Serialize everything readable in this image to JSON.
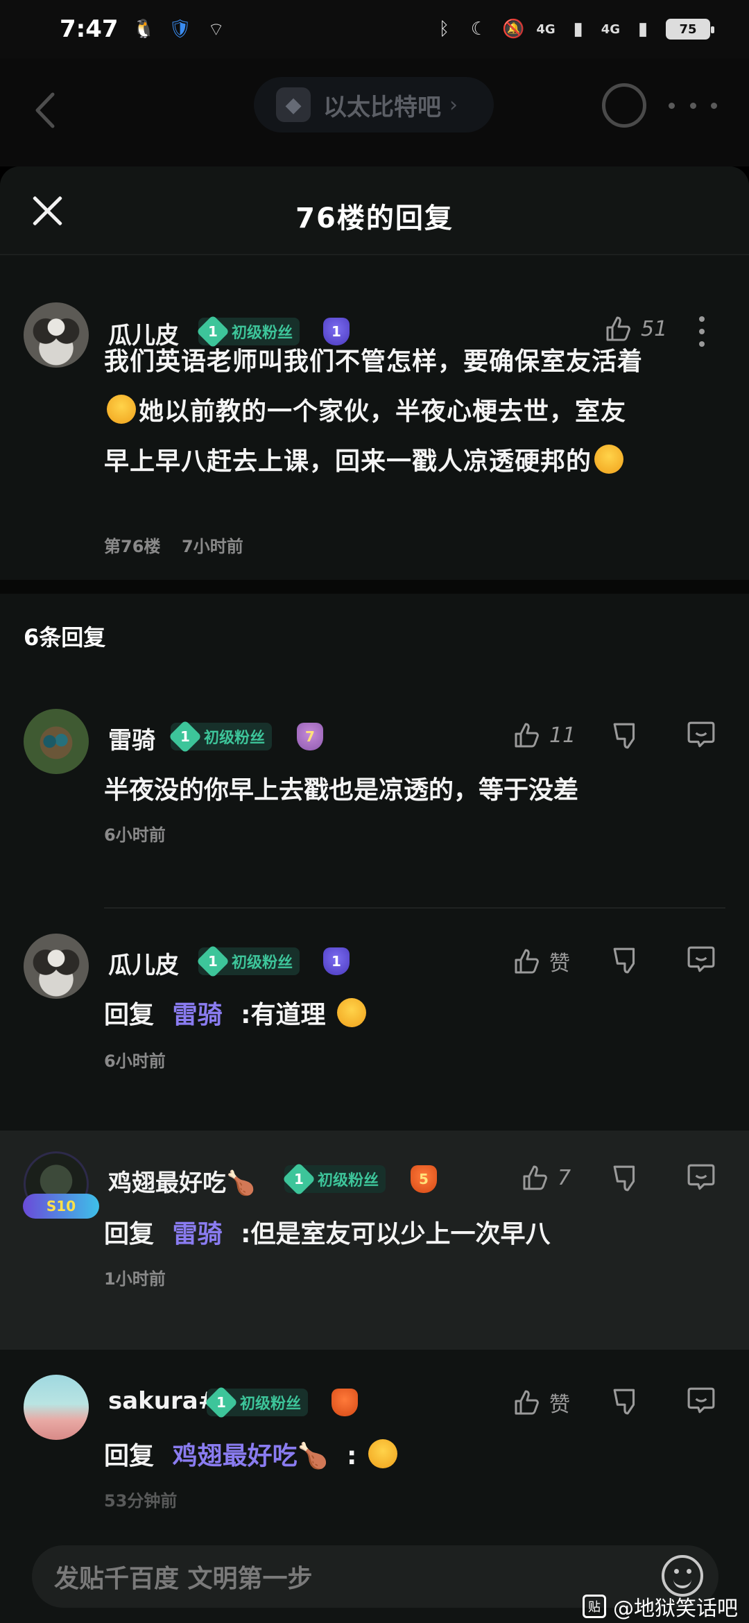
{
  "status_bar": {
    "time": "7:47",
    "network_1": "4G",
    "network_2": "4G",
    "battery": "75"
  },
  "page_header": {
    "forum_name": "以太比特吧"
  },
  "sheet": {
    "title": "76楼的回复"
  },
  "main_post": {
    "username": "瓜儿皮",
    "fan_level": "1",
    "fan_label": "初级粉丝",
    "user_level": "1",
    "likes": "51",
    "text_line1": "我们英语老师叫我们不管怎样，要确保室友活着",
    "text_line2": "她以前教的一个家伙，半夜心梗去世，室友",
    "text_line3": "早上早八赶去上课，回来一戳人凉透硬邦的",
    "floor": "第76楼",
    "time": "7小时前"
  },
  "replies_header": "6条回复",
  "replies": [
    {
      "username": "雷骑",
      "fan_level": "1",
      "fan_label": "初级粉丝",
      "user_level": "7",
      "likes": "11",
      "text": "半夜没的你早上去戳也是凉透的，等于没差",
      "time": "6小时前"
    },
    {
      "username": "瓜儿皮",
      "fan_level": "1",
      "fan_label": "初级粉丝",
      "user_level": "1",
      "likes": "赞",
      "prefix": "回复",
      "mention": "雷骑",
      "text": ":有道理",
      "time": "6小时前"
    },
    {
      "username": "鸡翅最好吃🍗",
      "fan_level": "1",
      "fan_label": "初级粉丝",
      "user_level": "5",
      "likes": "7",
      "prefix": "回复",
      "mention": "雷骑",
      "text": ":但是室友可以少上一次早八",
      "time": "1小时前",
      "avatar_badge": "S10"
    },
    {
      "username": "sakura#",
      "fan_level": "1",
      "fan_label": "初级粉丝",
      "user_level": "",
      "likes": "赞",
      "prefix": "回复",
      "mention": "鸡翅最好吃🍗",
      "text": ":",
      "time": "53分钟前"
    }
  ],
  "input": {
    "placeholder": "发贴千百度 文明第一步"
  },
  "watermark": {
    "logo": "贴",
    "text": "@地狱笑话吧"
  }
}
